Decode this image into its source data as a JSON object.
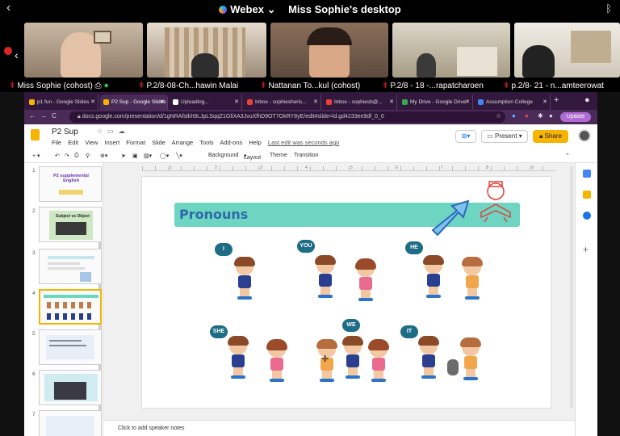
{
  "app": {
    "name": "Webex",
    "window_title": "Miss Sophie's desktop"
  },
  "participants": [
    {
      "name": "Miss Sophie (cohost)",
      "muted": false
    },
    {
      "name": "P.2/8-08-Ch...hawin Malai",
      "muted": true
    },
    {
      "name": "Nattanan To...kul (cohost)",
      "muted": true
    },
    {
      "name": "P.2/8 - 18 -...rapatcharoen",
      "muted": true
    },
    {
      "name": "p.2/8- 21 - n...amteerowat",
      "muted": true
    }
  ],
  "browser": {
    "tabs": [
      {
        "label": "p1 fun - Google Slides",
        "active": false
      },
      {
        "label": "P2 Sup - Google Slides",
        "active": true
      },
      {
        "label": "Uploading...",
        "active": false
      },
      {
        "label": "Inbox - sophiesheris...",
        "active": false
      },
      {
        "label": "Inbox - sophiesb@...",
        "active": false
      },
      {
        "label": "My Drive - Google Drive",
        "active": false
      },
      {
        "label": "Assumption College",
        "active": false
      }
    ],
    "url": "docs.google.com/presentation/d/1gNRAfstkh9LJpLSqqZ1GliXA3JvuXfhD9OT7OkRY8yE/edit#slide=id.gd4233ee9df_0_0",
    "update_label": "Update"
  },
  "doc": {
    "title": "P2 Sup",
    "menu": [
      "File",
      "Edit",
      "View",
      "Insert",
      "Format",
      "Slide",
      "Arrange",
      "Tools",
      "Add-ons",
      "Help"
    ],
    "last_edit": "Last edit was seconds ago",
    "present_label": "Present",
    "share_label": "Share",
    "toolbar": {
      "background": "Background",
      "layout": "Layout",
      "theme": "Theme",
      "transition": "Transition"
    }
  },
  "filmstrip": {
    "numbers": [
      "1",
      "2",
      "3",
      "4",
      "5",
      "6",
      "7"
    ],
    "selected": 4,
    "thumb1_title": "P2 supplemental English",
    "thumb2_title": "Subject vs Object"
  },
  "slide": {
    "title": "Pronouns",
    "bubbles": [
      "I",
      "YOU",
      "HE",
      "SHE",
      "WE",
      "IT"
    ]
  },
  "notes_placeholder": "Click to add speaker notes",
  "ruler_ticks": [
    "1",
    "2",
    "3",
    "4",
    "5",
    "6",
    "7",
    "8",
    "9"
  ]
}
